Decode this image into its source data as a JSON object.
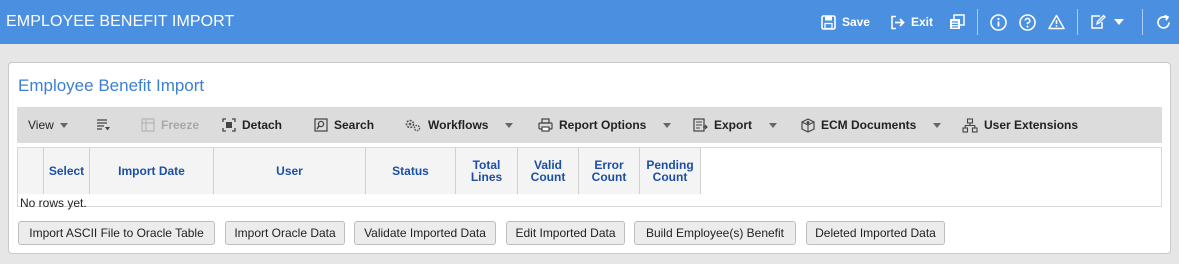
{
  "window": {
    "title": "EMPLOYEE BENEFIT IMPORT",
    "save_label": "Save",
    "exit_label": "Exit"
  },
  "panel": {
    "title": "Employee Benefit Import"
  },
  "toolbar": {
    "view": "View",
    "freeze": "Freeze",
    "detach": "Detach",
    "search": "Search",
    "workflows": "Workflows",
    "report_options": "Report Options",
    "export": "Export",
    "ecm_documents": "ECM Documents",
    "user_extensions": "User Extensions"
  },
  "grid": {
    "columns": [
      {
        "line1": "Select",
        "line2": ""
      },
      {
        "line1": "Import Date",
        "line2": ""
      },
      {
        "line1": "User",
        "line2": ""
      },
      {
        "line1": "Status",
        "line2": ""
      },
      {
        "line1": "Total",
        "line2": "Lines"
      },
      {
        "line1": "Valid",
        "line2": "Count"
      },
      {
        "line1": "Error",
        "line2": "Count"
      },
      {
        "line1": "Pending",
        "line2": "Count"
      }
    ],
    "empty_message": "No rows yet."
  },
  "actions": [
    "Import ASCII File to Oracle Table",
    "Import Oracle Data",
    "Validate Imported Data",
    "Edit Imported Data",
    "Build Employee(s) Benefit",
    "Deleted Imported Data"
  ]
}
